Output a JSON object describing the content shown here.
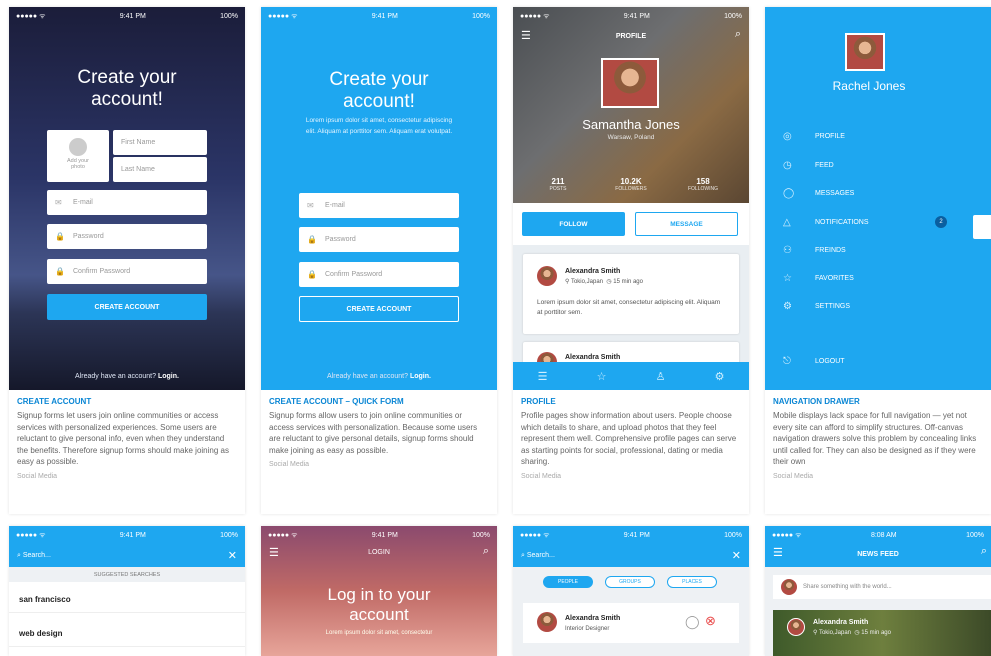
{
  "status": {
    "dots": "●●●●● ᯤ",
    "battery": "100%",
    "time_941": "9:41 PM",
    "time_808": "8:08 AM"
  },
  "create": {
    "heading": "Create your account!",
    "add_photo": "Add your photo",
    "first_name": "First Name",
    "last_name": "Last Name",
    "email": "E-mail",
    "password": "Password",
    "confirm": "Confirm Password",
    "button": "CREATE ACCOUNT",
    "already": "Already have an account?",
    "login": "Login.",
    "lorem": "Lorem ipsum dolor sit amet, consectetur adipiscing elit. Aliquam at porttitor sem. Aliquam erat volutpat."
  },
  "profile": {
    "header": "PROFILE",
    "name": "Samantha Jones",
    "location": "Warsaw, Poland",
    "posts_n": "211",
    "posts_l": "POSTS",
    "followers_n": "10.2K",
    "followers_l": "FOLLOWERS",
    "following_n": "158",
    "following_l": "FOLLOWING",
    "follow": "FOLLOW",
    "message": "MESSAGE",
    "post_name": "Alexandra Smith",
    "post_loc": "Tokio,Japan",
    "post_time": "15 min ago",
    "post_text": "Lorem ipsum dolor sit amet, consectetur adipiscing elit. Aliquam at porttitor sem."
  },
  "drawer": {
    "name": "Rachel Jones",
    "items": [
      "PROFILE",
      "FEED",
      "MESSAGES",
      "NOTIFICATIONS",
      "FREINDS",
      "FAVORITES",
      "SETTINGS"
    ],
    "badge": "2",
    "logout": "LOGOUT"
  },
  "cards": [
    {
      "title": "CREATE ACCOUNT",
      "desc": "Signup forms let users join online communities or access services with personalized experiences. Some users are reluctant to give personal info, even when they understand the benefits. Therefore signup forms should make joining as easy as possible.",
      "cat": "Social Media"
    },
    {
      "title": "CREATE ACCOUNT – QUICK FORM",
      "desc": "Signup forms allow users to join online communities or access services with personalization. Because some users are reluctant to give personal details, signup forms should make joining as easy as possible.",
      "cat": "Social Media"
    },
    {
      "title": "PROFILE",
      "desc": "Profile pages show information about users. People choose which details to share, and upload photos that they feel represent them well. Comprehensive profile pages can serve as starting points for social, professional, dating or media sharing.",
      "cat": "Social Media"
    },
    {
      "title": "NAVIGATION DRAWER",
      "desc": "Mobile displays lack space for full navigation — yet not every site can afford to simplify structures. Off-canvas navigation drawers solve this problem by concealing links until called for. They can also be designed as if they were their own",
      "cat": "Social Media"
    }
  ],
  "row2": {
    "search_placeholder": "Search...",
    "suggested": "SUGGESTED SEARCHES",
    "s1": "san francisco",
    "s2": "web design",
    "login_header": "LOGIN",
    "login_heading": "Log in to your account",
    "login_lorem": "Lorem ipsum dolor sit amet, consectetur",
    "tabs": [
      "PEOPLE",
      "GROUPS",
      "PLACES"
    ],
    "person_name": "Alexandra Smith",
    "person_role": "Interior Designer",
    "feed_header": "NEWS FEED",
    "share": "Share something with the world...",
    "feed_name": "Alexandra Smith",
    "feed_loc": "Tokio,Japan",
    "feed_time": "15 min ago"
  }
}
